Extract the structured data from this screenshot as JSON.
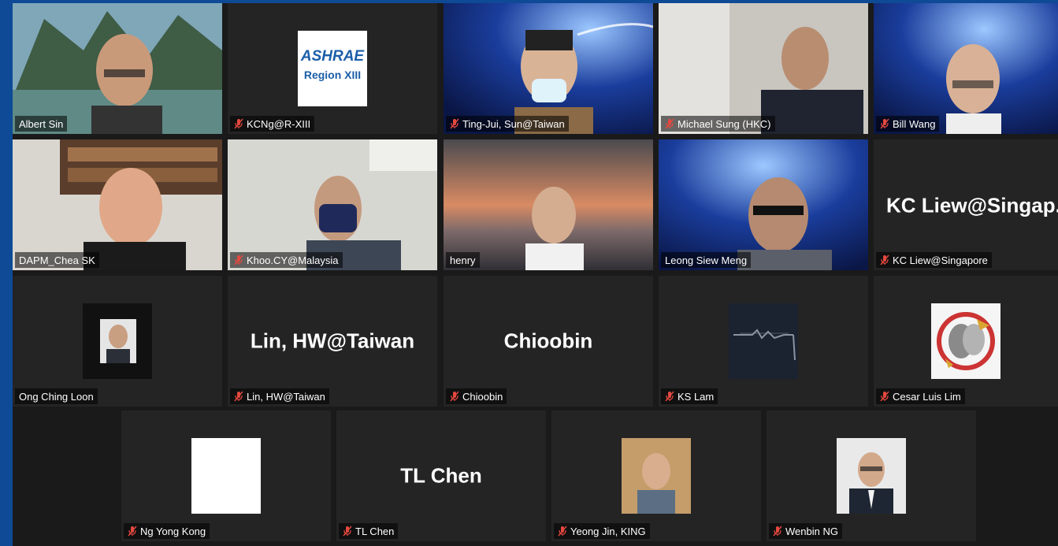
{
  "participants": {
    "albert": {
      "name": "Albert Sin"
    },
    "kcng": {
      "name": "KCNg@R-XIII",
      "logo_brand": "ASHRAE",
      "logo_sub": "Region XIII"
    },
    "tingjui": {
      "name": "Ting-Jui, Sun@Taiwan"
    },
    "michael": {
      "name": "Michael Sung (HKC)"
    },
    "bill": {
      "name": "Bill Wang"
    },
    "dapm": {
      "name": "DAPM_Chea SK"
    },
    "khoo": {
      "name": "Khoo.CY@Malaysia"
    },
    "henry": {
      "name": "henry"
    },
    "leong": {
      "name": "Leong Siew Meng"
    },
    "kcliew": {
      "name": "KC Liew@Singapore",
      "display": "KC  Liew@Singap."
    },
    "ong": {
      "name": "Ong Ching Loon"
    },
    "linhw": {
      "name": "Lin, HW@Taiwan",
      "display": "Lin, HW@Taiwan"
    },
    "chioobin": {
      "name": "Chioobin",
      "display": "Chioobin"
    },
    "kslam": {
      "name": "KS Lam"
    },
    "cesar": {
      "name": "Cesar Luis Lim"
    },
    "ngyong": {
      "name": "Ng Yong Kong"
    },
    "tlchen": {
      "name": "TL Chen",
      "display": "TL Chen"
    },
    "yeongjin": {
      "name": "Yeong Jin, KING"
    },
    "wenbin": {
      "name": "Wenbin NG"
    }
  },
  "colors": {
    "window_border": "#0e4a96",
    "tile_bg": "#242424",
    "active_speaker": "#c6e03c",
    "mute_icon": "#e5483f"
  }
}
